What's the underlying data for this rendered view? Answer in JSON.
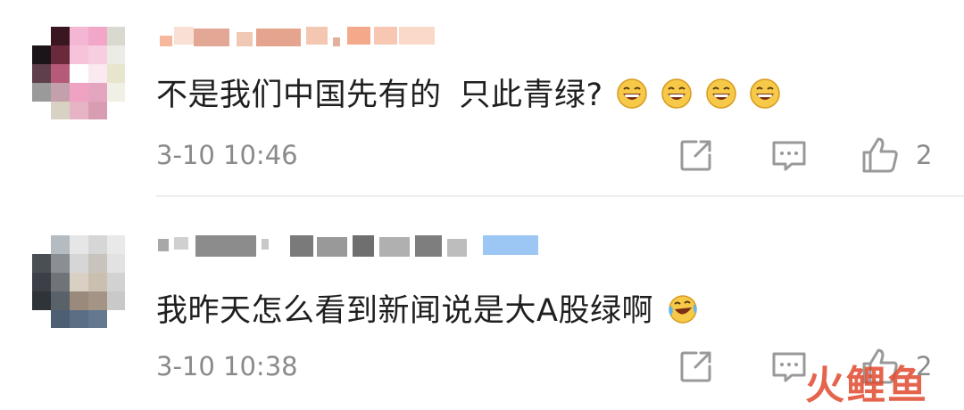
{
  "comments": [
    {
      "text_main": "不是我们中国先有的",
      "text_tail": "只此青绿?",
      "emojis": [
        "laughing-face",
        "laughing-face",
        "laughing-face",
        "laughing-face"
      ],
      "timestamp": "3-10 10:46",
      "like_count": "2"
    },
    {
      "text_main": "我昨天怎么看到新闻说是大A股绿啊",
      "emojis": [
        "crying-laughing-face"
      ],
      "timestamp": "3-10 10:38",
      "like_count": "2"
    }
  ],
  "watermark": "火鲤鱼",
  "colors": {
    "text": "#1f1f1f",
    "meta": "#8a8a8a",
    "icon": "#999999",
    "emoji_face": "#f7c948",
    "watermark": "#e14a2e"
  }
}
